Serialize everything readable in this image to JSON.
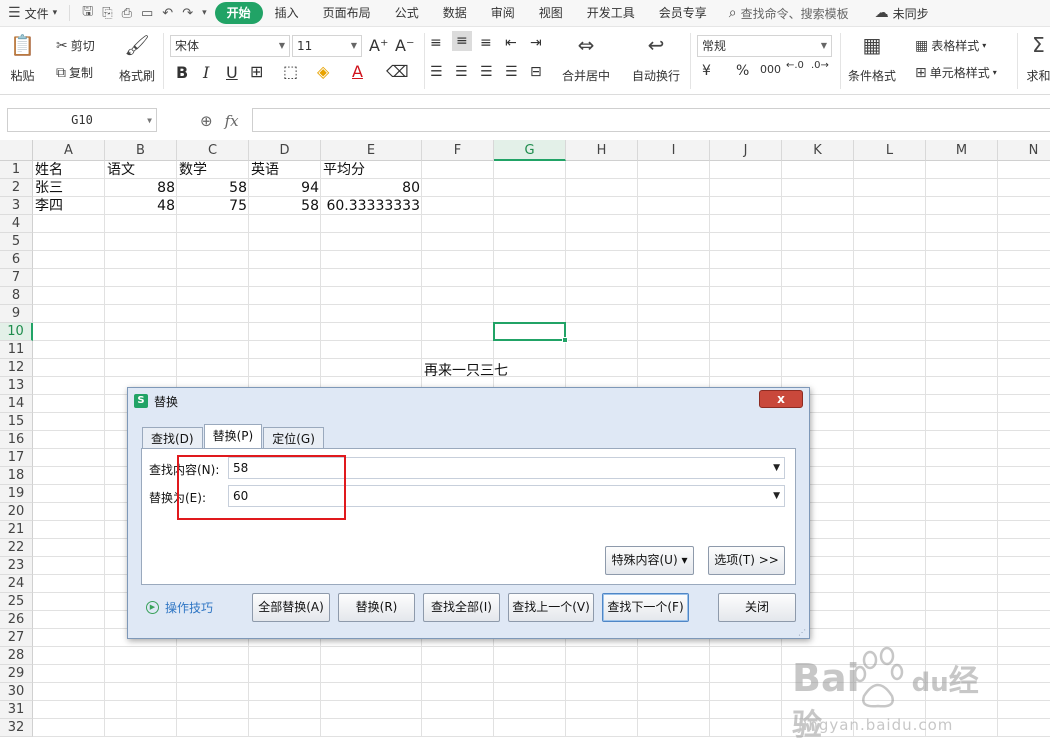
{
  "menubar": {
    "file_label": "文件",
    "tabs": [
      "开始",
      "插入",
      "页面布局",
      "公式",
      "数据",
      "审阅",
      "视图",
      "开发工具",
      "会员专享"
    ],
    "active_tab_index": 0,
    "search_label": "查找命令、搜索模板",
    "sync_label": "未同步"
  },
  "ribbon": {
    "paste": "粘贴",
    "cut": "剪切",
    "copy": "复制",
    "format_painter": "格式刷",
    "font_name": "宋体",
    "font_size": "11",
    "merge_center": "合并居中",
    "wrap_text": "自动换行",
    "number_format": "常规",
    "conditional_format": "条件格式",
    "table_style": "表格样式",
    "cell_style": "单元格样式",
    "sum": "求和",
    "currency_symbol": "¥",
    "percent_symbol": "%",
    "thousands_symbol": "000"
  },
  "formula_bar": {
    "name_box": "G10",
    "fx": "fx",
    "content": ""
  },
  "sheet": {
    "columns": [
      "A",
      "B",
      "C",
      "D",
      "E",
      "F",
      "G",
      "H",
      "I",
      "J",
      "K",
      "L",
      "M",
      "N"
    ],
    "selected_column": "G",
    "rows": [
      1,
      2,
      3,
      4,
      5,
      6,
      7,
      8,
      9,
      10,
      11,
      12,
      13,
      14,
      15,
      16,
      17,
      18,
      19,
      20,
      21,
      22,
      23,
      24,
      25,
      26,
      27,
      28,
      29,
      30,
      31,
      32
    ],
    "selected_row": 10,
    "data": [
      [
        "姓名",
        "语文",
        "数学",
        "英语",
        "平均分"
      ],
      [
        "张三",
        "88",
        "58",
        "94",
        "80"
      ],
      [
        "李四",
        "48",
        "75",
        "58",
        "60.33333333"
      ]
    ],
    "floating_text": "再来一只三七"
  },
  "dialog": {
    "title": "替换",
    "close_label": "x",
    "tabs": [
      "查找(D)",
      "替换(P)",
      "定位(G)"
    ],
    "active_tab_index": 1,
    "find_label": "查找内容(N):",
    "find_value": "58",
    "replace_label": "替换为(E):",
    "replace_value": "60",
    "special_button": "特殊内容(U) ▾",
    "options_button": "选项(T) >>",
    "tips_label": "操作技巧",
    "buttons": {
      "replace_all": "全部替换(A)",
      "replace": "替换(R)",
      "find_all": "查找全部(I)",
      "find_prev": "查找上一个(V)",
      "find_next": "查找下一个(F)",
      "close": "关闭"
    }
  },
  "watermark": {
    "brand": "Bai",
    "brand2": "du",
    "cn": "经验",
    "url": "jingyan.baidu.com"
  },
  "colors": {
    "accent": "#21a366",
    "highlight_box": "#e0191d"
  }
}
